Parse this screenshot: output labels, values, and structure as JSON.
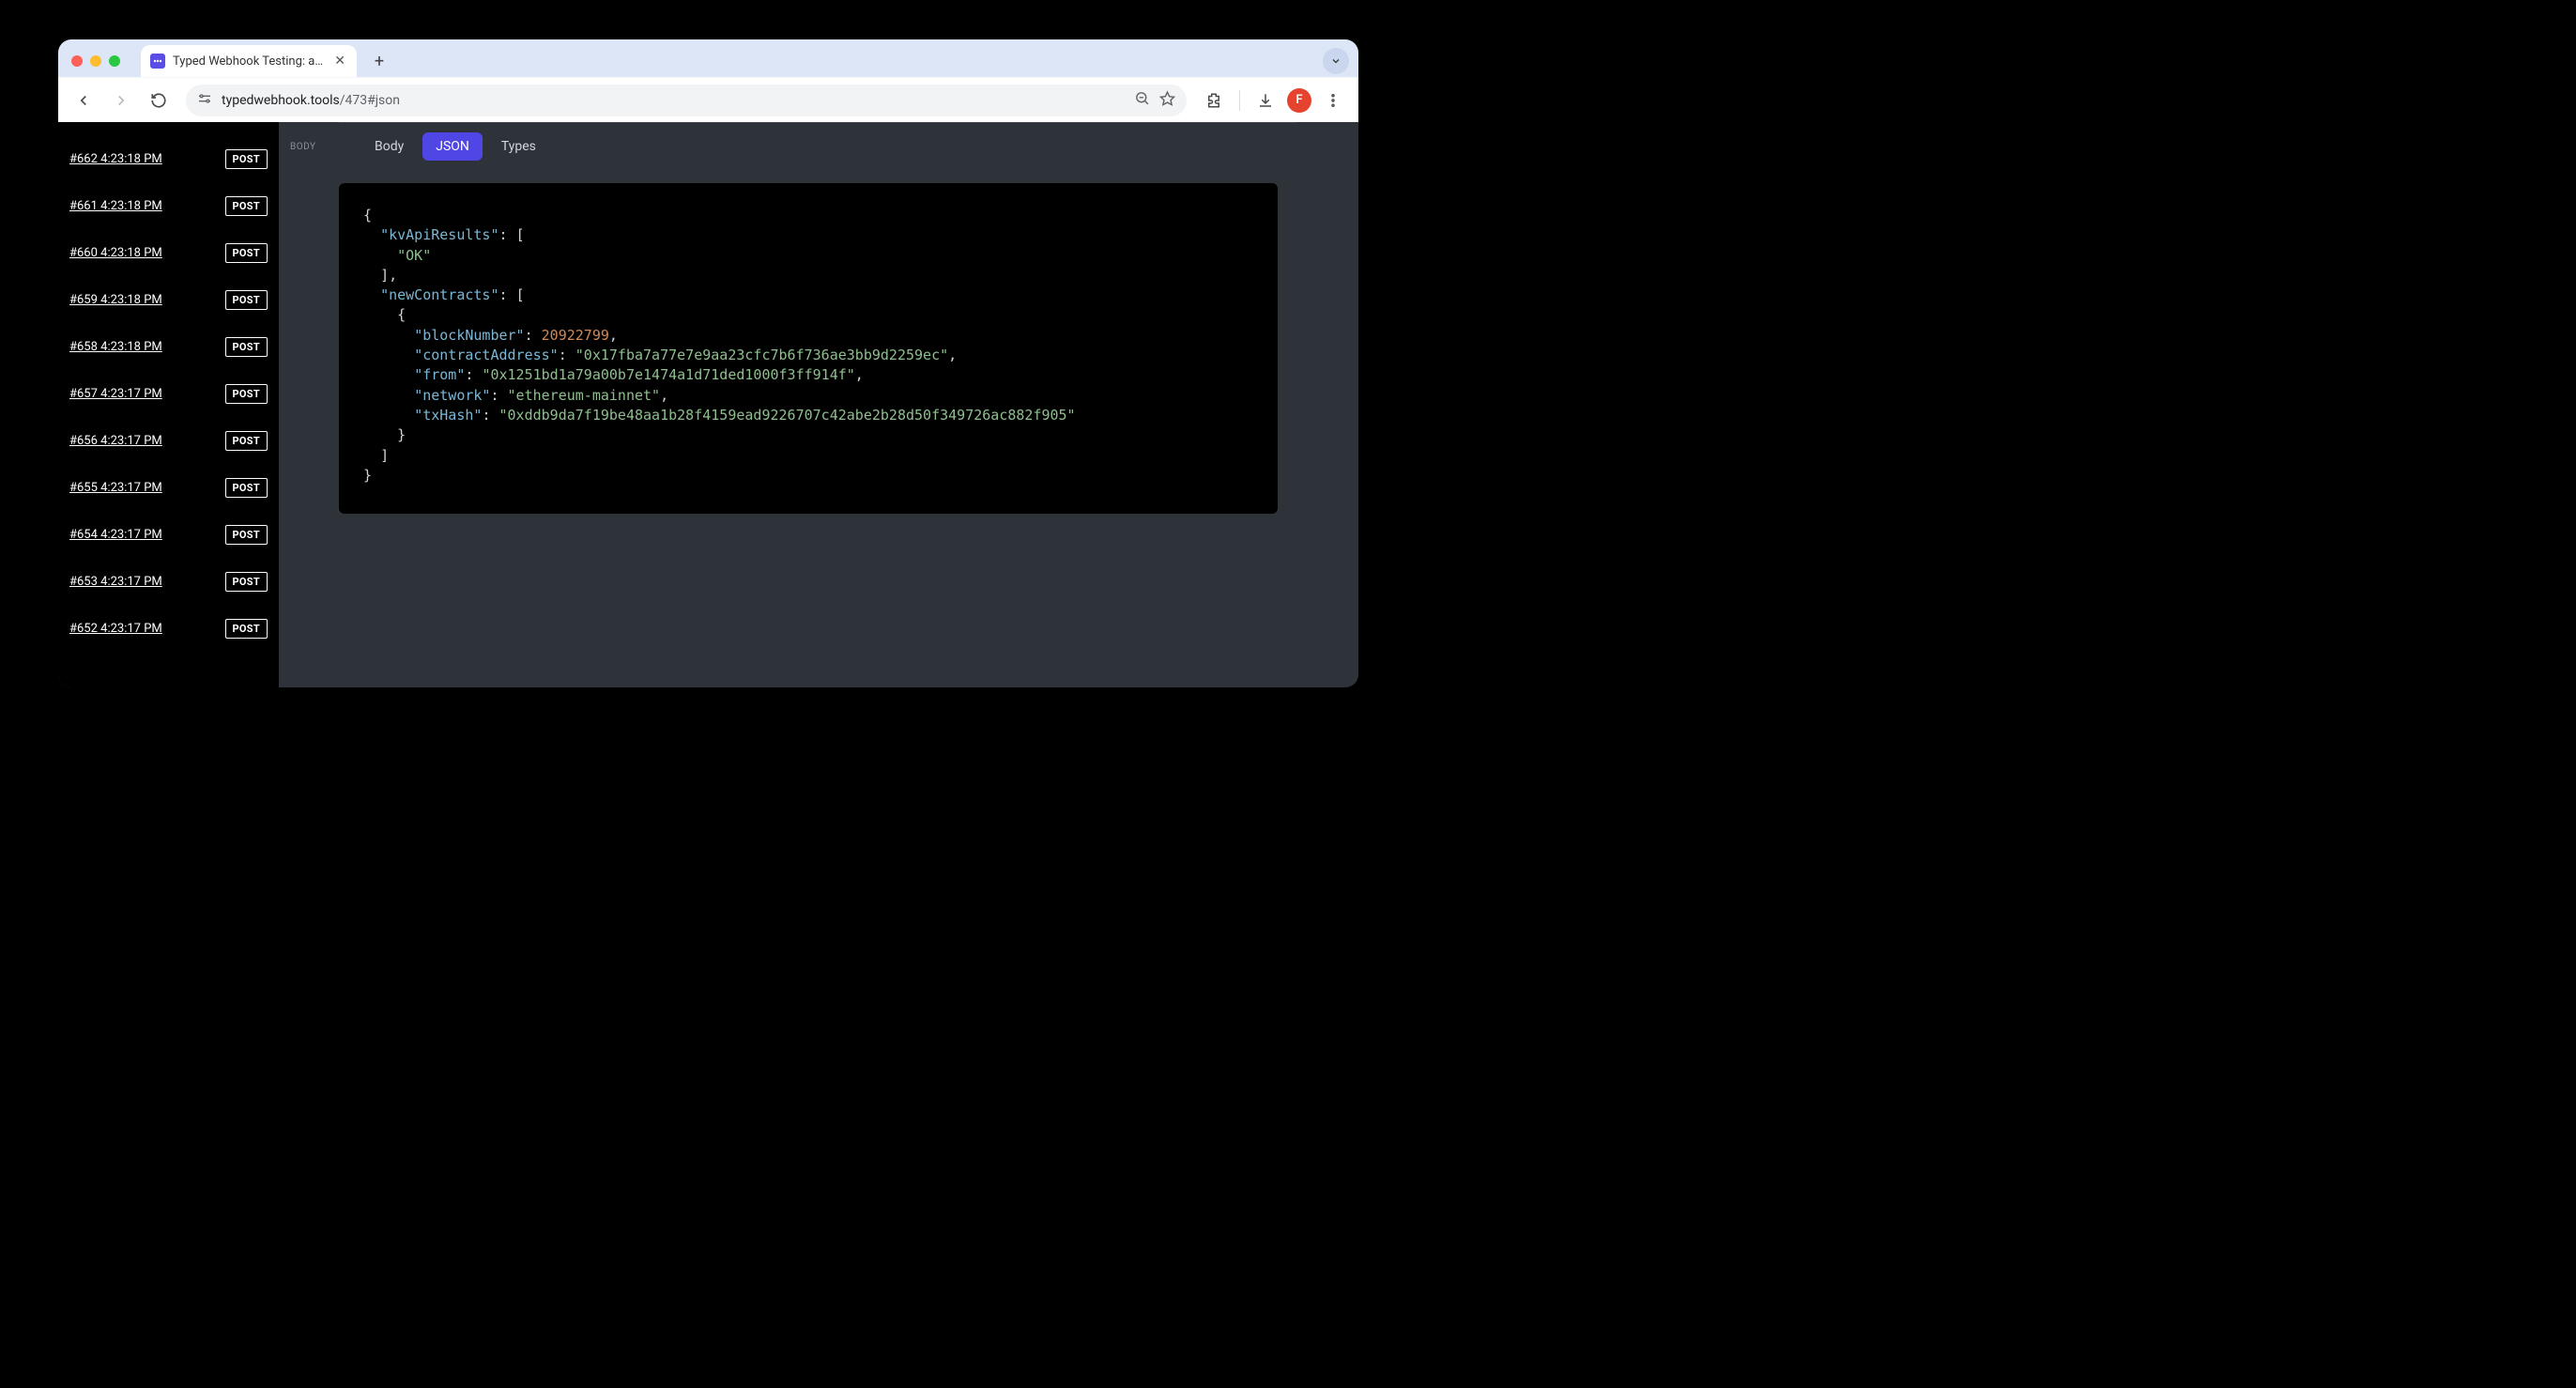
{
  "browser": {
    "tab_title": "Typed Webhook Testing: a tool",
    "url_host": "typedwebhook.tools",
    "url_path": "/473#json",
    "avatar_initial": "F"
  },
  "sidebar": {
    "requests": [
      {
        "label": "#662 4:23:18 PM",
        "method": "POST"
      },
      {
        "label": "#661 4:23:18 PM",
        "method": "POST"
      },
      {
        "label": "#660 4:23:18 PM",
        "method": "POST"
      },
      {
        "label": "#659 4:23:18 PM",
        "method": "POST"
      },
      {
        "label": "#658 4:23:18 PM",
        "method": "POST"
      },
      {
        "label": "#657 4:23:17 PM",
        "method": "POST"
      },
      {
        "label": "#656 4:23:17 PM",
        "method": "POST"
      },
      {
        "label": "#655 4:23:17 PM",
        "method": "POST"
      },
      {
        "label": "#654 4:23:17 PM",
        "method": "POST"
      },
      {
        "label": "#653 4:23:17 PM",
        "method": "POST"
      },
      {
        "label": "#652 4:23:17 PM",
        "method": "POST"
      }
    ]
  },
  "main": {
    "section_label": "BODY",
    "tabs": {
      "body": "Body",
      "json": "JSON",
      "types": "Types"
    }
  },
  "payload": {
    "kvApiResults": [
      "OK"
    ],
    "newContracts": [
      {
        "blockNumber": 20922799,
        "contractAddress": "0x17fba7a77e7e9aa23cfc7b6f736ae3bb9d2259ec",
        "from": "0x1251bd1a79a00b7e1474a1d71ded1000f3ff914f",
        "network": "ethereum-mainnet",
        "txHash": "0xddb9da7f19be48aa1b28f4159ead9226707c42abe2b28d50f349726ac882f905"
      }
    ]
  }
}
